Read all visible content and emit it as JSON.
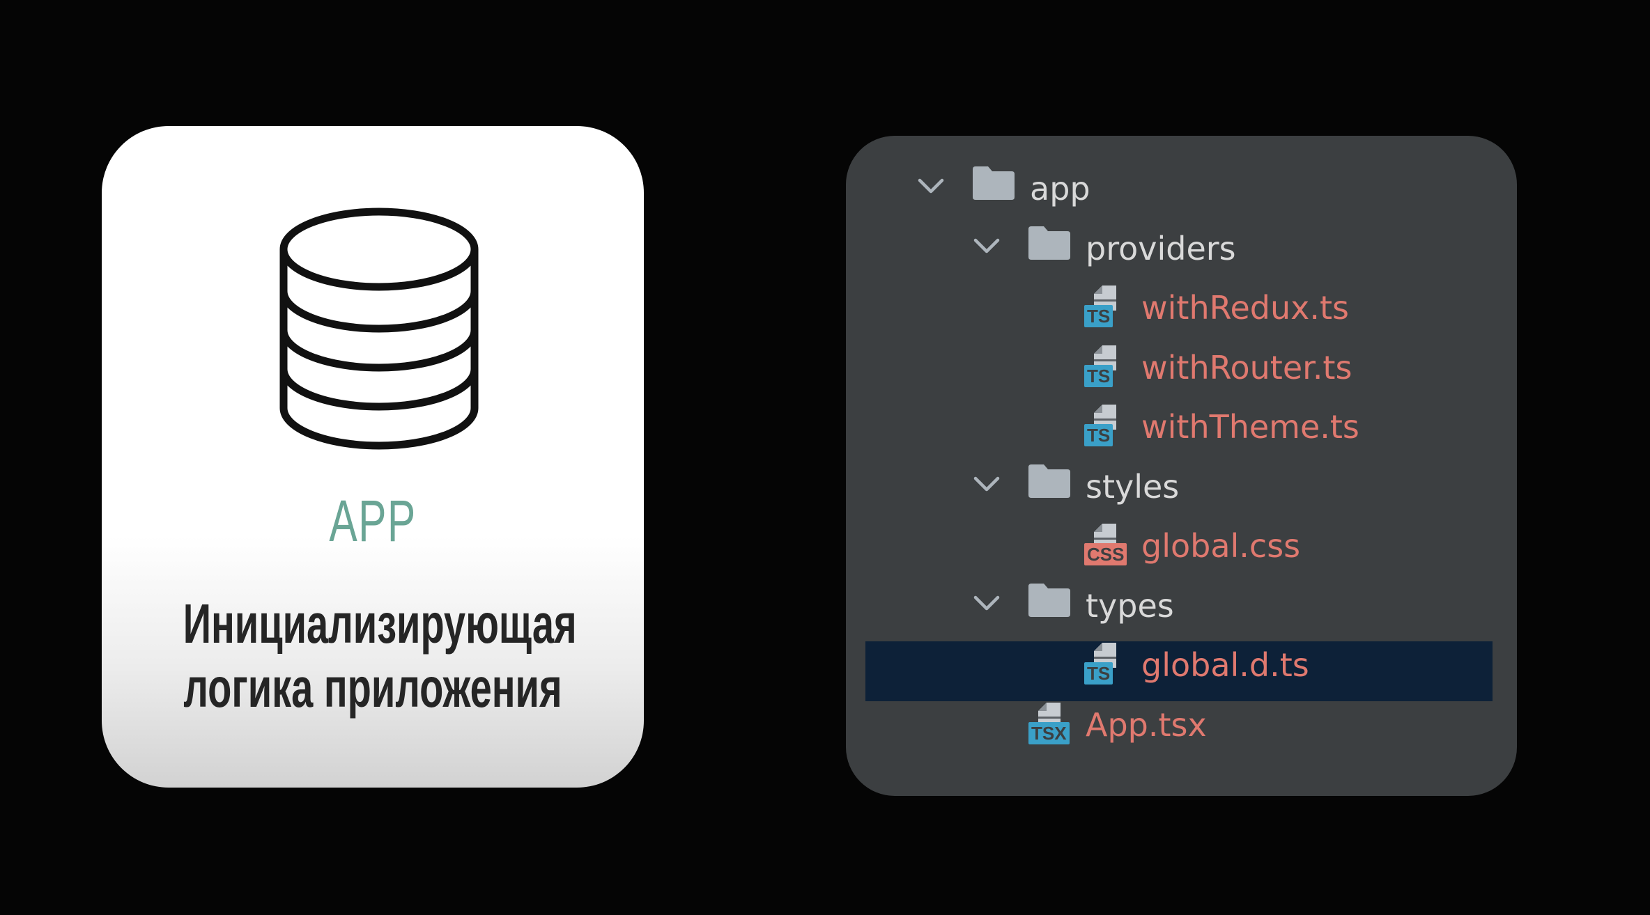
{
  "card": {
    "icon": "database-icon",
    "title": "APP",
    "title_color": "#6aa595",
    "description": "Инициализирующая\nлогика приложения"
  },
  "tree": {
    "folder_color": "#adb5bc",
    "text_color": "#d9d9d9",
    "file_color": "#e0796f",
    "ts_badge_color": "#3aa0c8",
    "css_badge_color": "#e0796f",
    "selected_bg": "#0d2138",
    "items": [
      {
        "kind": "folder",
        "name": "app",
        "depth": 0,
        "expanded": true,
        "icon": "folder-icon"
      },
      {
        "kind": "folder",
        "name": "providers",
        "depth": 1,
        "expanded": true,
        "icon": "folder-icon"
      },
      {
        "kind": "file",
        "name": "withRedux.ts",
        "depth": 2,
        "badge": "TS",
        "icon": "ts-file-icon"
      },
      {
        "kind": "file",
        "name": "withRouter.ts",
        "depth": 2,
        "badge": "TS",
        "icon": "ts-file-icon"
      },
      {
        "kind": "file",
        "name": "withTheme.ts",
        "depth": 2,
        "badge": "TS",
        "icon": "ts-file-icon"
      },
      {
        "kind": "folder",
        "name": "styles",
        "depth": 1,
        "expanded": true,
        "icon": "folder-icon"
      },
      {
        "kind": "file",
        "name": "global.css",
        "depth": 2,
        "badge": "CSS",
        "icon": "css-file-icon"
      },
      {
        "kind": "folder",
        "name": "types",
        "depth": 1,
        "expanded": true,
        "icon": "folder-icon"
      },
      {
        "kind": "file",
        "name": "global.d.ts",
        "depth": 2,
        "badge": "TS",
        "icon": "ts-file-icon",
        "selected": true
      },
      {
        "kind": "file",
        "name": "App.tsx",
        "depth": 1,
        "badge": "TSX",
        "icon": "tsx-file-icon"
      }
    ]
  }
}
